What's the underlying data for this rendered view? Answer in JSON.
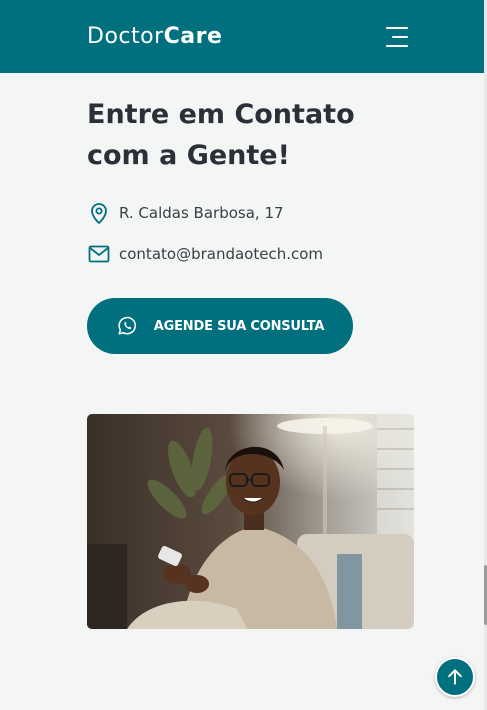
{
  "header": {
    "logo_light": "Doctor",
    "logo_bold": "Care",
    "menu_icon": "hamburger-menu-icon"
  },
  "contact": {
    "title": "Entre em Contato com a Gente!",
    "address": "R. Caldas Barbosa, 17",
    "email": "contato@brandaotech.com",
    "address_icon": "map-pin-icon",
    "email_icon": "envelope-icon"
  },
  "cta": {
    "label": "AGENDE SUA CONSULTA",
    "icon": "whatsapp-icon"
  },
  "photo": {
    "alt": "Homem sorrindo usando o celular"
  },
  "back_to_top": {
    "icon": "arrow-up-icon"
  },
  "colors": {
    "brand": "#00707e",
    "background": "#f4f5f5",
    "text": "#2b3038"
  }
}
